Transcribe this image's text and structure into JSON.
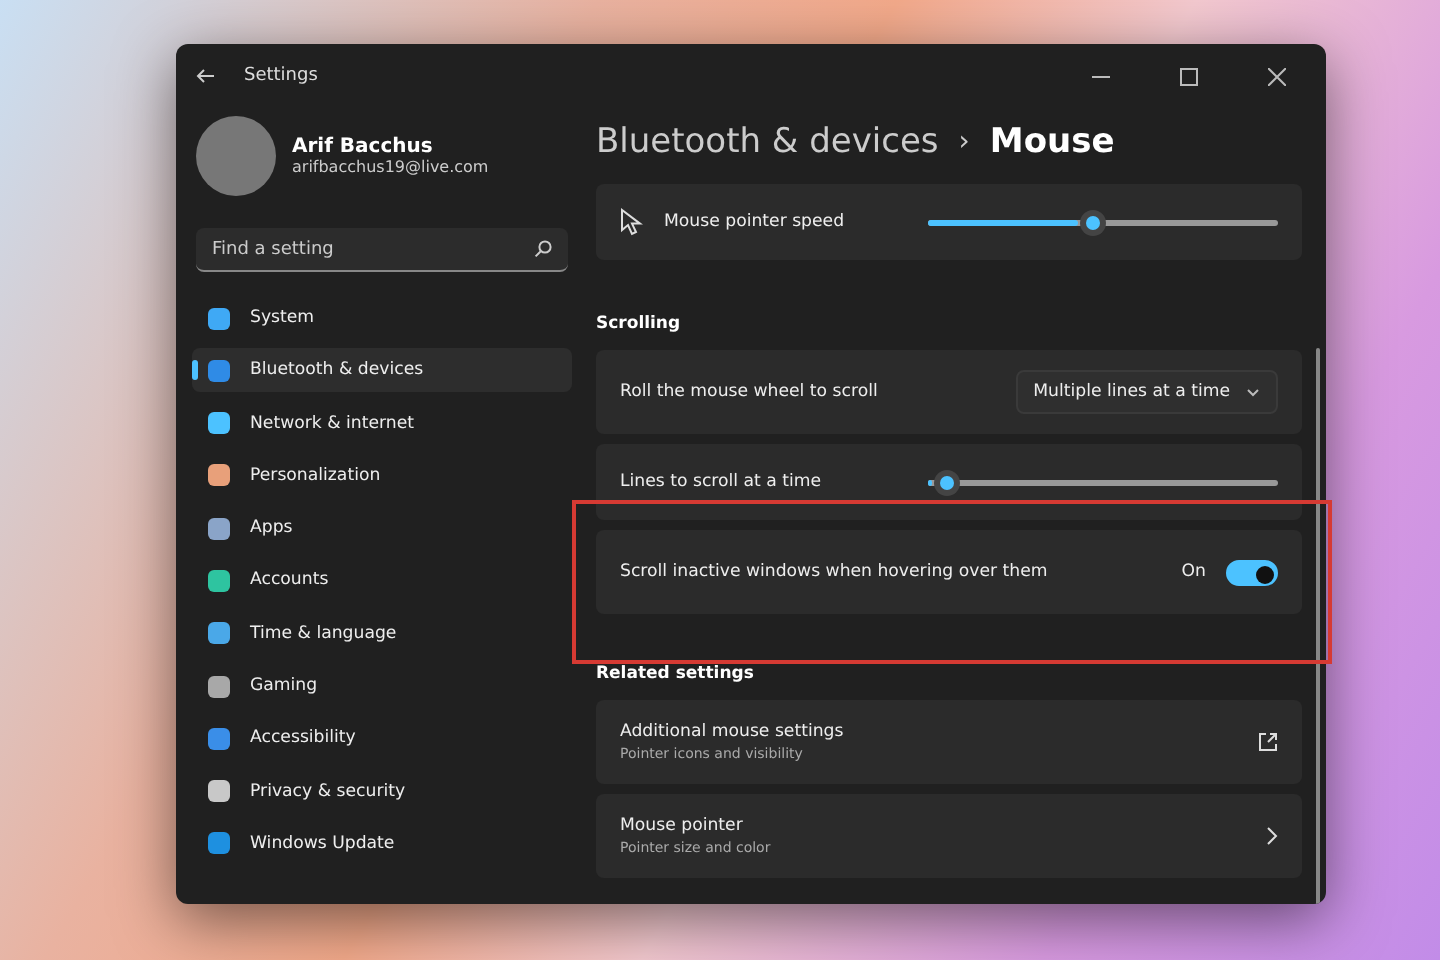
{
  "window": {
    "title": "Settings"
  },
  "account": {
    "name": "Arif Bacchus",
    "email": "arifbacchus19@live.com"
  },
  "search": {
    "placeholder": "Find a setting"
  },
  "sidebar": {
    "items": [
      {
        "label": "System",
        "selected": false,
        "color": "#3fa9f5"
      },
      {
        "label": "Bluetooth & devices",
        "selected": true,
        "color": "#2f8be6"
      },
      {
        "label": "Network & internet",
        "selected": false,
        "color": "#4cc2ff"
      },
      {
        "label": "Personalization",
        "selected": false,
        "color": "#e8a07a"
      },
      {
        "label": "Apps",
        "selected": false,
        "color": "#8aa4c8"
      },
      {
        "label": "Accounts",
        "selected": false,
        "color": "#2ec4a0"
      },
      {
        "label": "Time & language",
        "selected": false,
        "color": "#4aa8e8"
      },
      {
        "label": "Gaming",
        "selected": false,
        "color": "#a8a8a8"
      },
      {
        "label": "Accessibility",
        "selected": false,
        "color": "#3a8ee8"
      },
      {
        "label": "Privacy & security",
        "selected": false,
        "color": "#c8c8c8"
      },
      {
        "label": "Windows Update",
        "selected": false,
        "color": "#1e90e0"
      }
    ]
  },
  "breadcrumb": {
    "parent": "Bluetooth & devices",
    "separator": "›",
    "current": "Mouse"
  },
  "sections": [
    {
      "rows": [
        {
          "kind": "slider",
          "label": "Mouse pointer speed",
          "level": 0.47
        }
      ]
    },
    {
      "heading": "Scrolling",
      "rows": [
        {
          "kind": "dropdown",
          "label": "Roll the mouse wheel to scroll",
          "value": "Multiple lines at a time"
        },
        {
          "kind": "slider",
          "label": "Lines to scroll at a time",
          "level": 0.05
        },
        {
          "kind": "toggle",
          "label": "Scroll inactive windows when hovering over them",
          "state_text": "On",
          "on": true
        }
      ]
    },
    {
      "heading": "Related settings",
      "rows": [
        {
          "kind": "external",
          "label": "Additional mouse settings",
          "description": "Pointer icons and visibility"
        },
        {
          "kind": "link",
          "label": "Mouse pointer",
          "description": "Pointer size and color"
        }
      ]
    }
  ]
}
